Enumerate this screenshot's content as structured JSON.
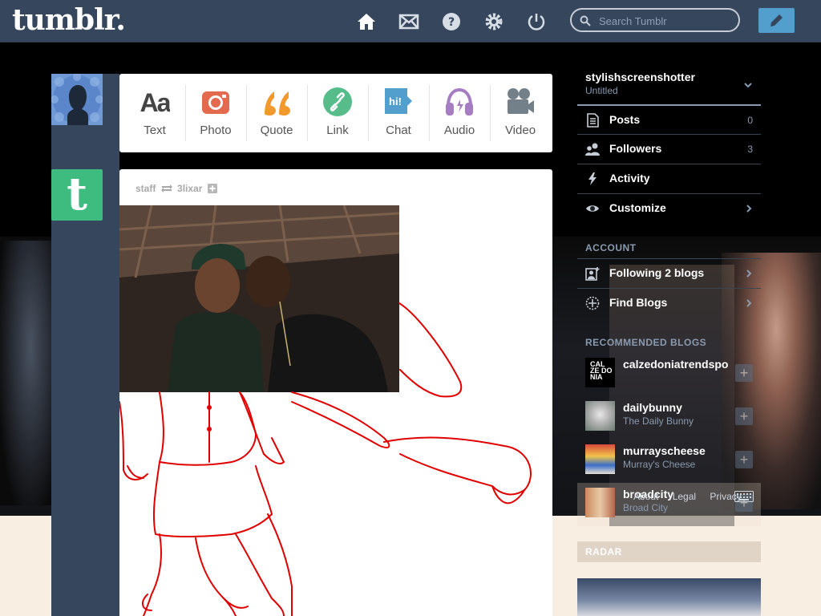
{
  "header": {
    "logo": "tumblr.",
    "search_placeholder": "Search Tumblr",
    "nav_icons": [
      "home-icon",
      "mail-icon",
      "help-icon",
      "settings-icon",
      "power-icon"
    ],
    "compose_icon": "pencil-icon"
  },
  "post_types": [
    {
      "label": "Text",
      "icon": "text-icon",
      "color": "#444444"
    },
    {
      "label": "Photo",
      "icon": "camera-icon",
      "color": "#e46a4f"
    },
    {
      "label": "Quote",
      "icon": "quote-icon",
      "color": "#f2992e"
    },
    {
      "label": "Link",
      "icon": "link-icon",
      "color": "#56bc8a"
    },
    {
      "label": "Chat",
      "icon": "chat-icon",
      "color": "#529ecc"
    },
    {
      "label": "Audio",
      "icon": "headphones-icon",
      "color": "#a77dc2"
    },
    {
      "label": "Video",
      "icon": "video-camera-icon",
      "color": "#748089"
    }
  ],
  "post": {
    "author": "staff",
    "reblogged_from": "3lixar"
  },
  "sidebar": {
    "blog_name": "stylishscreenshotter",
    "blog_title": "Untitled",
    "rows": [
      {
        "label": "Posts",
        "count": "0",
        "icon": "posts-icon"
      },
      {
        "label": "Followers",
        "count": "3",
        "icon": "followers-icon"
      },
      {
        "label": "Activity",
        "count": "",
        "icon": "lightning-icon"
      },
      {
        "label": "Customize",
        "count": "",
        "icon": "eye-icon"
      }
    ],
    "account_header": "ACCOUNT",
    "account_rows": [
      {
        "label": "Following 2 blogs",
        "icon": "following-icon"
      },
      {
        "label": "Find Blogs",
        "icon": "compass-icon"
      }
    ],
    "recommended_header": "RECOMMENDED BLOGS",
    "recommended": [
      {
        "name": "calzedoniatrendspo",
        "sub": "",
        "thumb_text": "CAL ZE DO NIA"
      },
      {
        "name": "dailybunny",
        "sub": "The Daily Bunny"
      },
      {
        "name": "murrayscheese",
        "sub": "Murray's Cheese"
      },
      {
        "name": "broadcity",
        "sub": "Broad City"
      }
    ],
    "footer": {
      "about": "About",
      "legal": "Legal",
      "privacy": "Privacy"
    },
    "radar_header": "RADAR"
  },
  "colors": {
    "topbar": "#36465d",
    "accent": "#529ecc",
    "tumblr_green": "#3ebc7f",
    "drawing": "#e00000"
  }
}
